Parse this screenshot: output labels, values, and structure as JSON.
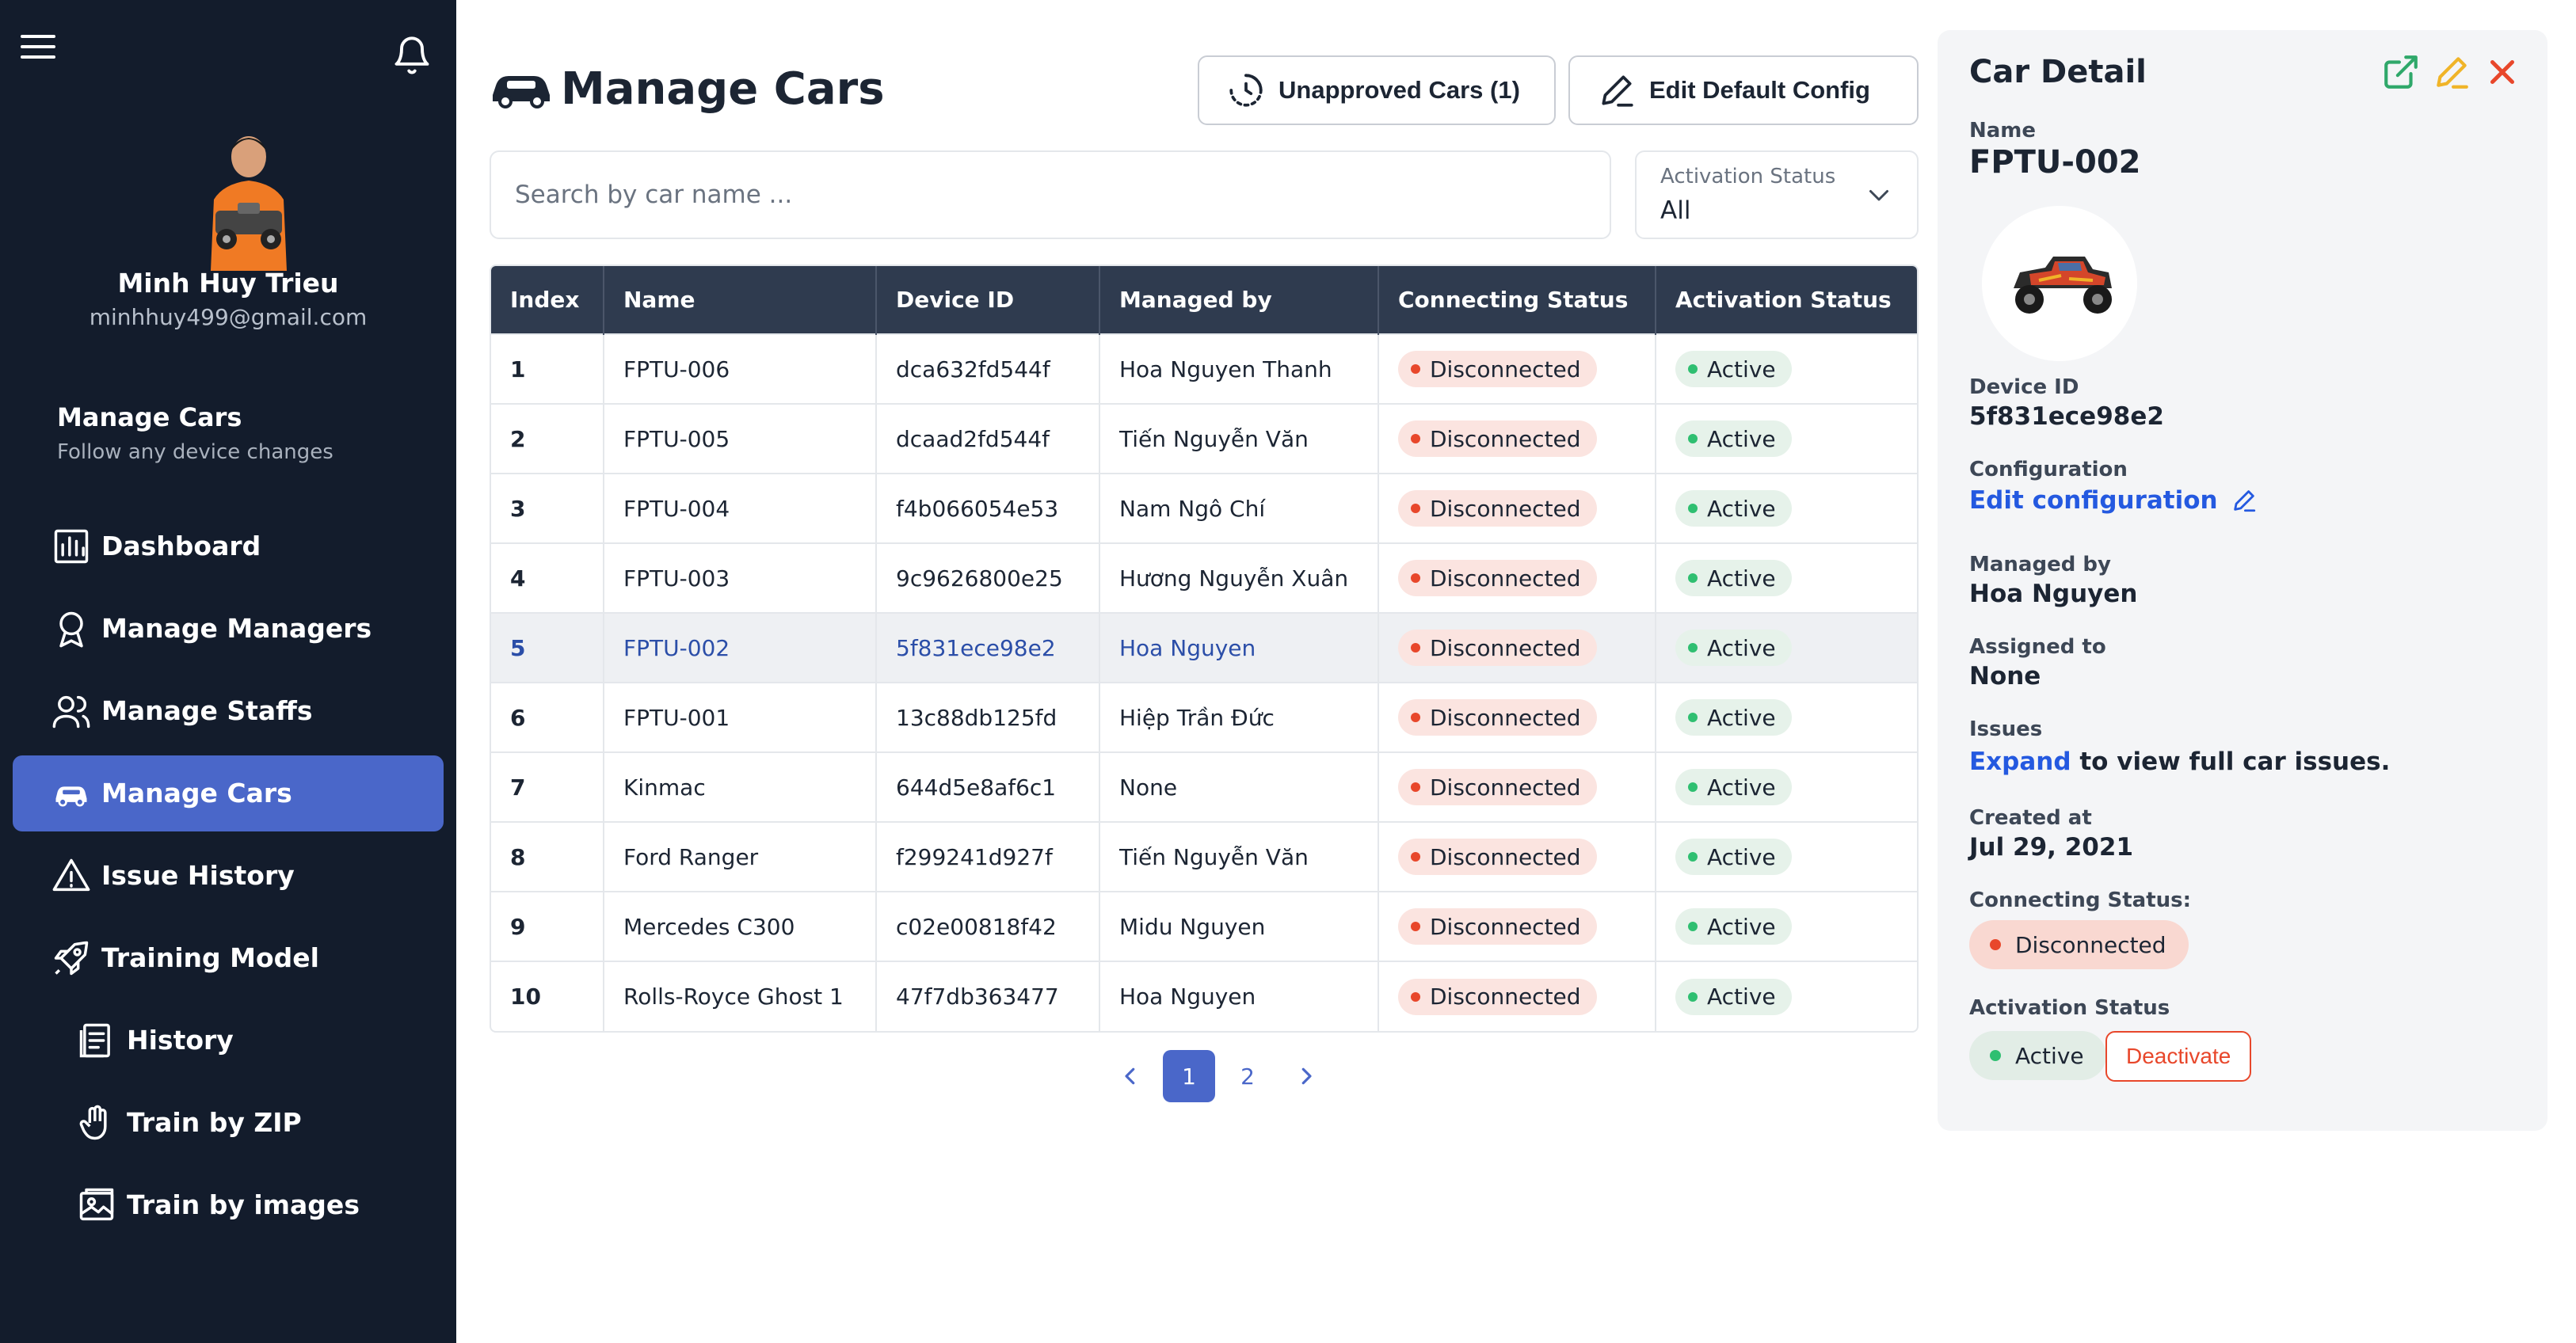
{
  "sidebar": {
    "user": {
      "name": "Minh Huy Trieu",
      "email": "minhhuy499@gmail.com"
    },
    "section": {
      "title": "Manage Cars",
      "subtitle": "Follow any device changes"
    },
    "items": [
      {
        "label": "Dashboard",
        "icon": "bar-chart-icon"
      },
      {
        "label": "Manage Managers",
        "icon": "award-icon"
      },
      {
        "label": "Manage Staffs",
        "icon": "users-icon"
      },
      {
        "label": "Manage Cars",
        "icon": "car-icon",
        "active": true
      },
      {
        "label": "Issue History",
        "icon": "warning-icon"
      },
      {
        "label": "Training Model",
        "icon": "rocket-icon"
      },
      {
        "label": "History",
        "icon": "document-icon"
      },
      {
        "label": "Train by ZIP",
        "icon": "hand-icon"
      },
      {
        "label": "Train by images",
        "icon": "image-icon"
      }
    ]
  },
  "header": {
    "title": "Manage Cars",
    "unapproved_label": "Unapproved Cars (1)",
    "edit_config_label": "Edit Default Config"
  },
  "filters": {
    "search_placeholder": "Search by car name ...",
    "activation_label": "Activation Status",
    "activation_value": "All"
  },
  "table": {
    "columns": [
      "Index",
      "Name",
      "Device ID",
      "Managed by",
      "Connecting Status",
      "Activation Status"
    ],
    "rows": [
      {
        "index": "1",
        "name": "FPTU-006",
        "device_id": "dca632fd544f",
        "managed_by": "Hoa Nguyen Thanh",
        "connecting": "Disconnected",
        "activation": "Active"
      },
      {
        "index": "2",
        "name": "FPTU-005",
        "device_id": "dcaad2fd544f",
        "managed_by": "Tiến Nguyễn Văn",
        "connecting": "Disconnected",
        "activation": "Active"
      },
      {
        "index": "3",
        "name": "FPTU-004",
        "device_id": "f4b066054e53",
        "managed_by": "Nam Ngô Chí",
        "connecting": "Disconnected",
        "activation": "Active"
      },
      {
        "index": "4",
        "name": "FPTU-003",
        "device_id": "9c9626800e25",
        "managed_by": "Hương Nguyễn Xuân",
        "connecting": "Disconnected",
        "activation": "Active"
      },
      {
        "index": "5",
        "name": "FPTU-002",
        "device_id": "5f831ece98e2",
        "managed_by": "Hoa Nguyen",
        "connecting": "Disconnected",
        "activation": "Active",
        "selected": true
      },
      {
        "index": "6",
        "name": "FPTU-001",
        "device_id": "13c88db125fd",
        "managed_by": "Hiệp Trần Đức",
        "connecting": "Disconnected",
        "activation": "Active"
      },
      {
        "index": "7",
        "name": "Kinmac",
        "device_id": "644d5e8af6c1",
        "managed_by": "None",
        "connecting": "Disconnected",
        "activation": "Active"
      },
      {
        "index": "8",
        "name": "Ford Ranger",
        "device_id": "f299241d927f",
        "managed_by": "Tiến Nguyễn Văn",
        "connecting": "Disconnected",
        "activation": "Active"
      },
      {
        "index": "9",
        "name": "Mercedes C300",
        "device_id": "c02e00818f42",
        "managed_by": "Midu Nguyen",
        "connecting": "Disconnected",
        "activation": "Active"
      },
      {
        "index": "10",
        "name": "Rolls-Royce Ghost 1",
        "device_id": "47f7db363477",
        "managed_by": "Hoa Nguyen",
        "connecting": "Disconnected",
        "activation": "Active"
      }
    ]
  },
  "pagination": {
    "pages": [
      "1",
      "2"
    ],
    "current": "1"
  },
  "detail": {
    "title": "Car Detail",
    "name_label": "Name",
    "name_value": "FPTU-002",
    "device_label": "Device ID",
    "device_value": "5f831ece98e2",
    "config_label": "Configuration",
    "config_link": "Edit configuration",
    "managed_label": "Managed by",
    "managed_value": "Hoa Nguyen",
    "assigned_label": "Assigned to",
    "assigned_value": "None",
    "issues_label": "Issues",
    "issues_link": "Expand",
    "issues_text": "to view full car issues.",
    "created_label": "Created at",
    "created_value": "Jul 29, 2021",
    "connecting_label": "Connecting Status:",
    "connecting_value": "Disconnected",
    "activation_label": "Activation Status",
    "activation_value": "Active",
    "deactivate_label": "Deactivate"
  },
  "colors": {
    "sidebar_bg": "#131c2c",
    "accent": "#4a67c9",
    "table_header": "#2f3b4f",
    "disconnected": "#e8472b",
    "active": "#2fbf71",
    "link": "#2459e0"
  }
}
